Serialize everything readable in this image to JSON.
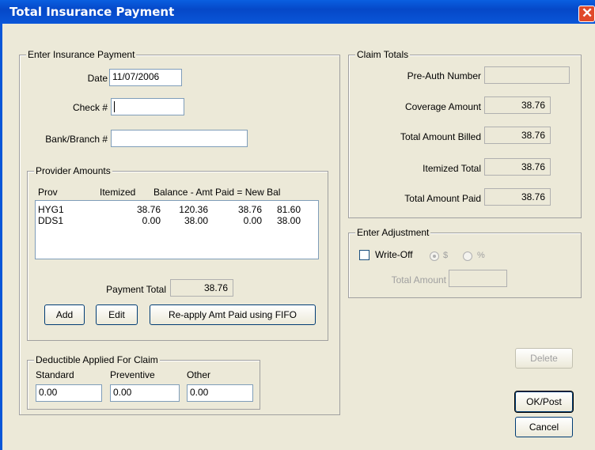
{
  "window": {
    "title": "Total Insurance Payment",
    "close_glyph": "✕"
  },
  "payment": {
    "legend": "Enter Insurance Payment",
    "date_label": "Date",
    "date_value": "11/07/2006",
    "check_label": "Check #",
    "check_value": "",
    "bank_label": "Bank/Branch #",
    "bank_value": ""
  },
  "provider": {
    "legend": "Provider Amounts",
    "headers": [
      "Prov",
      "Itemized",
      "Balance - Amt Paid = New Bal"
    ],
    "rows": [
      {
        "prov": "HYG1",
        "itemized": "38.76",
        "balance": "120.36",
        "paid": "38.76",
        "newbal": "81.60"
      },
      {
        "prov": "DDS1",
        "itemized": "0.00",
        "balance": "38.00",
        "paid": "0.00",
        "newbal": "38.00"
      }
    ],
    "payment_total_label": "Payment Total",
    "payment_total_value": "38.76",
    "add_label": "Add",
    "edit_label": "Edit",
    "reapply_label": "Re-apply Amt Paid using FIFO"
  },
  "deductible": {
    "legend": "Deductible Applied For Claim",
    "standard_label": "Standard",
    "standard_value": "0.00",
    "preventive_label": "Preventive",
    "preventive_value": "0.00",
    "other_label": "Other",
    "other_value": "0.00"
  },
  "claim_totals": {
    "legend": "Claim Totals",
    "preauth_label": "Pre-Auth Number",
    "preauth_value": "",
    "coverage_label": "Coverage Amount",
    "coverage_value": "38.76",
    "billed_label": "Total Amount Billed",
    "billed_value": "38.76",
    "itemized_label": "Itemized Total",
    "itemized_value": "38.76",
    "paid_label": "Total Amount Paid",
    "paid_value": "38.76"
  },
  "adjustment": {
    "legend": "Enter Adjustment",
    "writeoff_label": "Write-Off",
    "dollar_label": "$",
    "percent_label": "%",
    "total_amount_label": "Total Amount",
    "total_amount_value": ""
  },
  "buttons": {
    "delete": "Delete",
    "ok_post": "OK/Post",
    "cancel": "Cancel"
  }
}
